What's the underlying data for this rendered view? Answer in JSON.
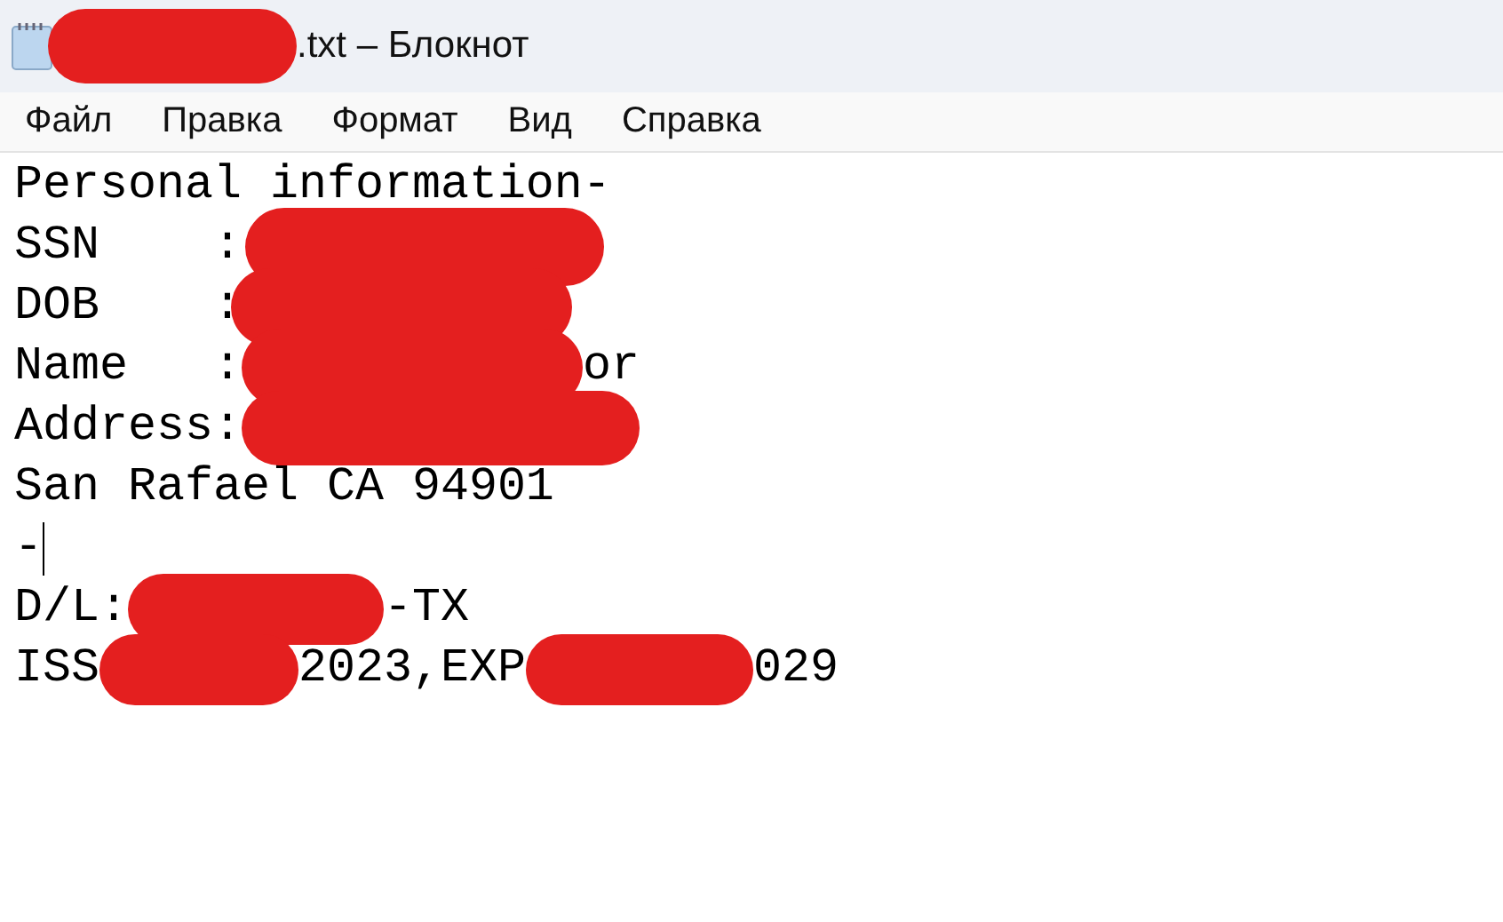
{
  "window": {
    "title_segments": [
      {
        "kind": "redacted"
      },
      {
        "kind": "text",
        "text": ".txt – Блокнот"
      }
    ]
  },
  "menu": [
    "Файл",
    "Правка",
    "Формат",
    "Вид",
    "Справка"
  ],
  "editor": {
    "lines": [
      [
        {
          "kind": "text",
          "text": "Personal information-"
        }
      ],
      [
        {
          "kind": "text",
          "text": "SSN    :"
        },
        {
          "kind": "redacted"
        }
      ],
      [
        {
          "kind": "text",
          "text": "DOB    :"
        },
        {
          "kind": "redacted"
        }
      ],
      [
        {
          "kind": "text",
          "text": "Name   :"
        },
        {
          "kind": "redacted"
        },
        {
          "kind": "text",
          "text": "or"
        }
      ],
      [
        {
          "kind": "text",
          "text": "Address:"
        },
        {
          "kind": "redacted"
        }
      ],
      [
        {
          "kind": "text",
          "text": "San Rafael CA 94901"
        }
      ],
      [
        {
          "kind": "text",
          "text": "-"
        },
        {
          "kind": "caret"
        }
      ],
      [
        {
          "kind": "text",
          "text": "D/L:"
        },
        {
          "kind": "redacted"
        },
        {
          "kind": "text",
          "text": "-TX"
        }
      ],
      [
        {
          "kind": "text",
          "text": "ISS"
        },
        {
          "kind": "redacted"
        },
        {
          "kind": "text",
          "text": "2023,EXP"
        },
        {
          "kind": "redacted"
        },
        {
          "kind": "text",
          "text": "029"
        }
      ]
    ]
  }
}
